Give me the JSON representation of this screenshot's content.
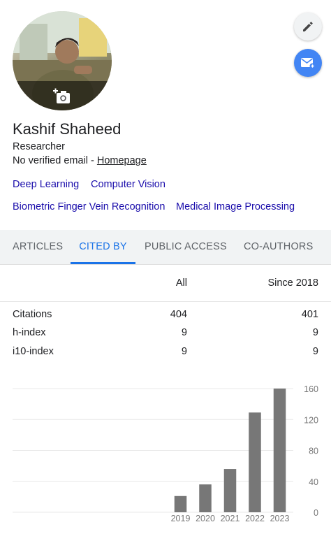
{
  "profile": {
    "name": "Kashif Shaheed",
    "role": "Researcher",
    "email_status": "No verified email - ",
    "homepage_label": "Homepage"
  },
  "icons": {
    "edit": "pencil-icon",
    "mail": "mail-plus-icon",
    "photo": "add-photo-icon"
  },
  "colors": {
    "link": "#1a0dab",
    "accent": "#1a73e8",
    "fab_blue": "#4285f4",
    "bar": "#777777"
  },
  "topics": [
    "Deep Learning",
    "Computer Vision",
    "Biometric Finger Vein Recognition",
    "Medical Image Processing"
  ],
  "tabs": [
    {
      "label": "ARTICLES",
      "active": false
    },
    {
      "label": "CITED BY",
      "active": true
    },
    {
      "label": "PUBLIC ACCESS",
      "active": false
    },
    {
      "label": "CO-AUTHORS",
      "active": false
    }
  ],
  "citations_table": {
    "columns": [
      "All",
      "Since 2018"
    ],
    "rows": [
      {
        "label": "Citations",
        "all": "404",
        "since": "401"
      },
      {
        "label": "h-index",
        "all": "9",
        "since": "9"
      },
      {
        "label": "i10-index",
        "all": "9",
        "since": "9"
      }
    ]
  },
  "chart_data": {
    "type": "bar",
    "categories": [
      "2019",
      "2020",
      "2021",
      "2022",
      "2023"
    ],
    "values": [
      21,
      36,
      56,
      129,
      160
    ],
    "title": "",
    "xlabel": "",
    "ylabel": "",
    "ylim": [
      0,
      160
    ],
    "yticks": [
      "0",
      "40",
      "80",
      "120",
      "160"
    ],
    "y_axis_side": "right",
    "grid": true
  }
}
